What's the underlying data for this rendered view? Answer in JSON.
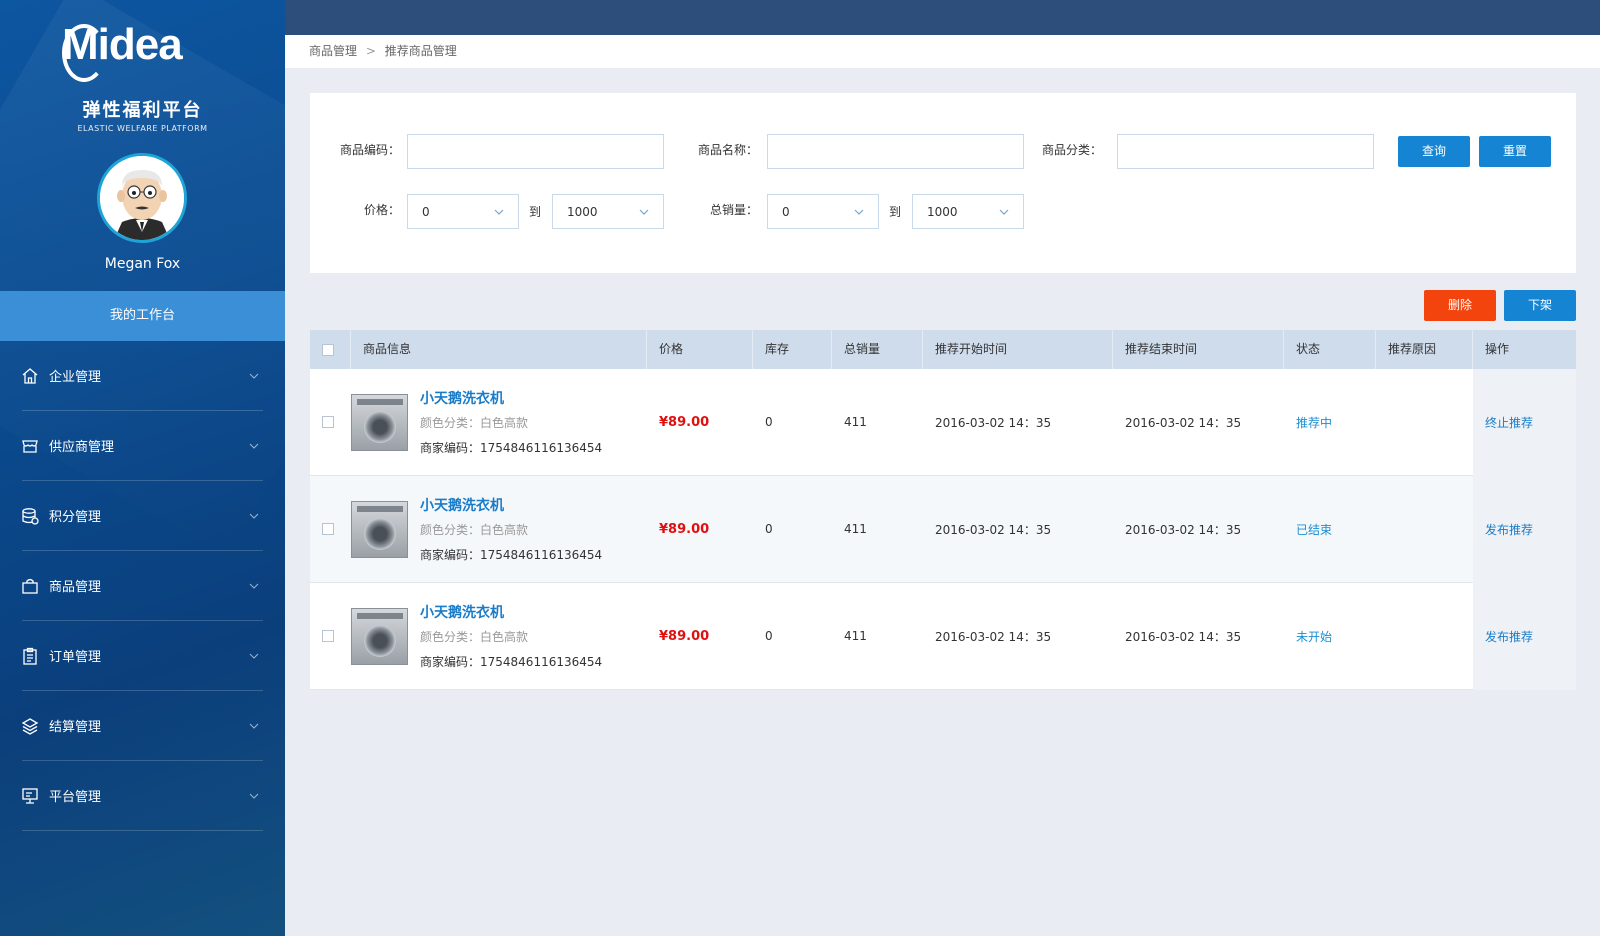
{
  "brand": {
    "logo_text": "Midea",
    "platform_name": "弹性福利平台",
    "platform_sub": "ELASTIC WELFARE PLATFORM"
  },
  "user": {
    "name": "Megan Fox"
  },
  "sidebar": {
    "workbench": "我的工作台",
    "items": [
      {
        "label": "企业管理",
        "icon": "home-icon"
      },
      {
        "label": "供应商管理",
        "icon": "store-icon"
      },
      {
        "label": "积分管理",
        "icon": "database-icon"
      },
      {
        "label": "商品管理",
        "icon": "shopping-bag-icon"
      },
      {
        "label": "订单管理",
        "icon": "clipboard-icon"
      },
      {
        "label": "结算管理",
        "icon": "layers-icon"
      },
      {
        "label": "平台管理",
        "icon": "monitor-icon"
      }
    ]
  },
  "breadcrumb": {
    "parent": "商品管理",
    "separator": ">",
    "current": "推荐商品管理"
  },
  "filters": {
    "code_label": "商品编码：",
    "code_value": "",
    "name_label": "商品名称：",
    "name_value": "",
    "category_label": "商品分类：",
    "category_value": "",
    "price_label": "价格：",
    "price_min": "0",
    "price_max": "1000",
    "sales_label": "总销量：",
    "sales_min": "0",
    "sales_max": "1000",
    "to": "到",
    "query_button": "查询",
    "reset_button": "重置"
  },
  "actions": {
    "delete_button": "删除",
    "offshelf_button": "下架"
  },
  "table": {
    "headers": [
      "商品信息",
      "价格",
      "库存",
      "总销量",
      "推荐开始时间",
      "推荐结束时间",
      "状态",
      "推荐原因",
      "操作"
    ],
    "rows": [
      {
        "name": "小天鹅洗衣机",
        "attr": "颜色分类：白色高款",
        "code": "商家编码：1754846116136454",
        "price": "¥89.00",
        "stock": "0",
        "sales": "411",
        "start": "2016-03-02 14：35",
        "end": "2016-03-02 14：35",
        "status": "推荐中",
        "reason": "",
        "op": "终止推荐"
      },
      {
        "name": "小天鹅洗衣机",
        "attr": "颜色分类：白色高款",
        "code": "商家编码：1754846116136454",
        "price": "¥89.00",
        "stock": "0",
        "sales": "411",
        "start": "2016-03-02 14：35",
        "end": "2016-03-02 14：35",
        "status": "已结束",
        "reason": "",
        "op": "发布推荐"
      },
      {
        "name": "小天鹅洗衣机",
        "attr": "颜色分类：白色高款",
        "code": "商家编码：1754846116136454",
        "price": "¥89.00",
        "stock": "0",
        "sales": "411",
        "start": "2016-03-02 14：35",
        "end": "2016-03-02 14：35",
        "status": "未开始",
        "reason": "",
        "op": "发布推荐"
      }
    ]
  },
  "colors": {
    "accent": "#1584d3",
    "danger": "#f4440d",
    "price": "#e01010",
    "sidebar": "#0b4a8e",
    "topbar": "#2d4e7a"
  }
}
